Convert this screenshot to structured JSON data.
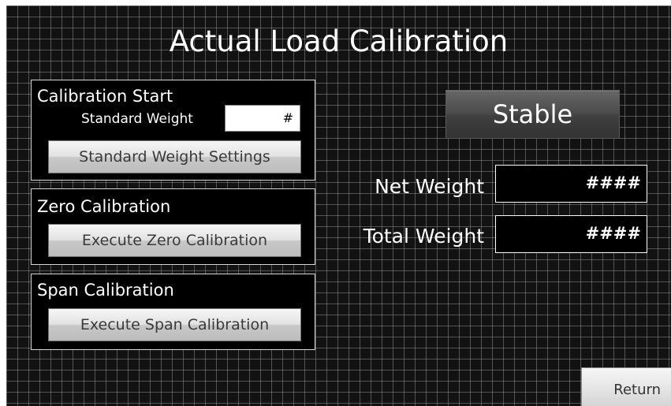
{
  "title": "Actual Load Calibration",
  "calibration_start": {
    "title": "Calibration Start",
    "standard_weight_label": "Standard Weight",
    "standard_weight_value": "#",
    "settings_button": "Standard Weight Settings"
  },
  "zero_calibration": {
    "title": "Zero Calibration",
    "button": "Execute Zero Calibration"
  },
  "span_calibration": {
    "title": "Span Calibration",
    "button": "Execute Span Calibration"
  },
  "status": {
    "label": "Stable"
  },
  "net_weight": {
    "label": "Net Weight",
    "value": "####"
  },
  "total_weight": {
    "label": "Total Weight",
    "value": "####"
  },
  "return_button": "Return",
  "colors": {
    "background": "#121212",
    "grid": "#afafaf",
    "panel": "#000000",
    "panel_border": "#d6d6d6",
    "text": "#ffffff"
  }
}
